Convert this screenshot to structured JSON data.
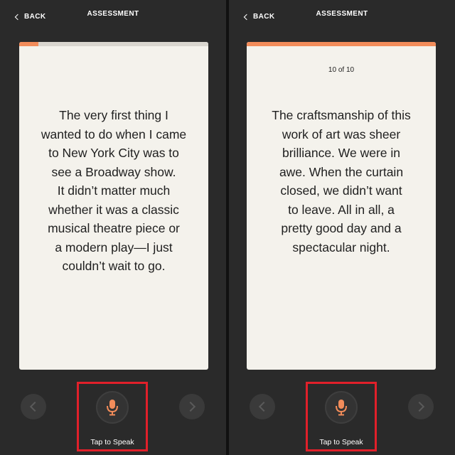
{
  "screens": [
    {
      "back_label": "BACK",
      "title": "ASSESSMENT",
      "progress_percent": 10,
      "counter": "",
      "passage_lines": [
        "The very first thing I",
        "wanted to do when I came",
        "to New York City was to",
        "see a Broadway show.",
        "It didn’t matter much",
        "whether it was a classic",
        "musical theatre piece or",
        "a modern play—I just",
        "couldn’t wait to go."
      ],
      "mic_label": "Tap to Speak"
    },
    {
      "back_label": "BACK",
      "title": "ASSESSMENT",
      "progress_percent": 100,
      "counter": "10 of 10",
      "passage_lines": [
        "The craftsmanship of this",
        "work of art was sheer",
        "brilliance. We were in",
        "awe. When the curtain",
        "closed, we didn’t want",
        "to leave. All in all, a",
        "pretty good day and a",
        "spectacular night."
      ],
      "mic_label": "Tap to Speak"
    }
  ],
  "colors": {
    "accent": "#f28c5a",
    "highlight_frame": "#e1202a",
    "background": "#2a2a2a",
    "card": "#f4f2ec"
  },
  "icons": [
    "chevron-left-icon",
    "microphone-icon",
    "chevron-right-icon"
  ]
}
